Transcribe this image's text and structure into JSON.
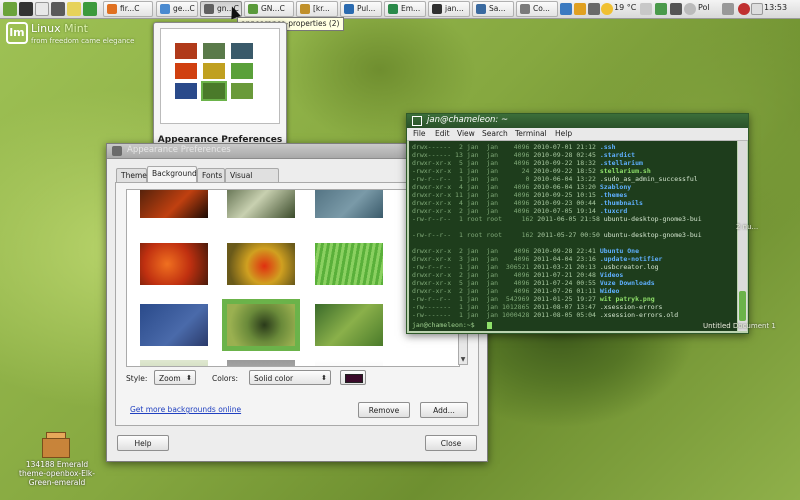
{
  "panel": {
    "tasks": [
      {
        "label": "fir...C",
        "active": false,
        "color": "#e07020"
      },
      {
        "label": "ge...C",
        "active": false,
        "color": "#4a8ad0"
      },
      {
        "label": "gn...C",
        "active": true,
        "color": "#606060"
      },
      {
        "label": "GN...C",
        "active": false,
        "color": "#5a9a3a"
      },
      {
        "label": "[kr...",
        "active": false,
        "color": "#c0902a"
      },
      {
        "label": "Pul...",
        "active": false,
        "color": "#2a6ab0"
      },
      {
        "label": "Em...",
        "active": false,
        "color": "#2a8a4a"
      },
      {
        "label": "jan...",
        "active": false,
        "color": "#303030"
      },
      {
        "label": "Sa...",
        "active": false,
        "color": "#3a6aa0"
      },
      {
        "label": "Co...",
        "active": false,
        "color": "#7a7a7a"
      }
    ],
    "weather": "19 °C",
    "user": "Pol",
    "clock": "13:53"
  },
  "tooltip": "appearance-properties (2)",
  "desktop": {
    "logo_mark": "lm",
    "logo_word1": "Linux",
    "logo_word2": "Mint",
    "tagline": "from freedom came elegance",
    "icon_label": "134188 Emerald theme-openbox-Elk-Green-emerald",
    "watermark1": "Untitled Document 1",
    "watermark2": "2 nu..."
  },
  "preview": {
    "title": "Appearance Preferences"
  },
  "appearance": {
    "title": "Appearance Preferences",
    "tabs": [
      "Theme",
      "Background",
      "Fonts",
      "Visual Effects"
    ],
    "active_tab": 1,
    "style_label": "Style:",
    "style_value": "Zoom",
    "colors_label": "Colors:",
    "colors_value": "Solid color",
    "swatch_color": "#3a0a2a",
    "get_more": "Get more backgrounds online",
    "remove": "Remove",
    "add": "Add...",
    "help": "Help",
    "close": "Close"
  },
  "terminal": {
    "title": "jan@chameleon: ~",
    "menu": [
      "File",
      "Edit",
      "View",
      "Search",
      "Terminal",
      "Help"
    ],
    "lines": [
      {
        "perm": "drwx------  2 jan  jan",
        "size": "4096",
        "date": "2010-07-01 21:12",
        "name": ".ssh",
        "kind": "dir"
      },
      {
        "perm": "drwx------ 13 jan  jan",
        "size": "4096",
        "date": "2010-09-28 02:45",
        "name": ".stardict",
        "kind": "dir"
      },
      {
        "perm": "drwxr-xr-x  5 jan  jan",
        "size": "4096",
        "date": "2010-09-22 18:32",
        "name": ".stellarium",
        "kind": "dir"
      },
      {
        "perm": "-rwxr-xr-x  1 jan  jan",
        "size": "24",
        "date": "2010-09-22 18:52",
        "name": "stellarium.sh",
        "kind": "exe"
      },
      {
        "perm": "-rw-r--r--  1 jan  jan",
        "size": "0",
        "date": "2010-06-04 13:22",
        "name": ".sudo_as_admin_successful",
        "kind": "file"
      },
      {
        "perm": "drwxr-xr-x  4 jan  jan",
        "size": "4096",
        "date": "2010-06-04 13:20",
        "name": "Szablony",
        "kind": "dir"
      },
      {
        "perm": "drwxr-xr-x 11 jan  jan",
        "size": "4096",
        "date": "2010-09-25 10:15",
        "name": ".themes",
        "kind": "dir"
      },
      {
        "perm": "drwxr-xr-x  4 jan  jan",
        "size": "4096",
        "date": "2010-09-23 00:44",
        "name": ".thumbnails",
        "kind": "dir"
      },
      {
        "perm": "drwxr-xr-x  2 jan  jan",
        "size": "4096",
        "date": "2010-07-05 19:14",
        "name": ".tuxcrd",
        "kind": "dir"
      },
      {
        "perm": "-rw-r--r--  1 root root",
        "size": "162",
        "date": "2011-06-05 21:58",
        "name": "ubuntu-desktop-gnome3-bui",
        "kind": "file"
      },
      {
        "perm": "",
        "size": "",
        "date": "",
        "name": "",
        "kind": "file"
      },
      {
        "perm": "-rw-r--r--  1 root root",
        "size": "162",
        "date": "2011-05-27 00:50",
        "name": "ubuntu-desktop-gnome3-bui",
        "kind": "file"
      },
      {
        "perm": "",
        "size": "",
        "date": "",
        "name": "",
        "kind": "file"
      },
      {
        "perm": "drwxr-xr-x  2 jan  jan",
        "size": "4096",
        "date": "2010-09-28 22:41",
        "name": "Ubuntu One",
        "kind": "dir"
      },
      {
        "perm": "drwxr-xr-x  3 jan  jan",
        "size": "4096",
        "date": "2011-04-04 23:16",
        "name": ".update-notifier",
        "kind": "dir"
      },
      {
        "perm": "-rw-r--r--  1 jan  jan",
        "size": "306521",
        "date": "2011-03-21 20:13",
        "name": ".usbcreator.log",
        "kind": "file"
      },
      {
        "perm": "drwxr-xr-x  2 jan  jan",
        "size": "4096",
        "date": "2011-07-21 20:48",
        "name": "Videos",
        "kind": "dir"
      },
      {
        "perm": "drwxr-xr-x  5 jan  jan",
        "size": "4096",
        "date": "2011-07-24 00:55",
        "name": "Vuze Downloads",
        "kind": "dir"
      },
      {
        "perm": "drwxr-xr-x  2 jan  jan",
        "size": "4096",
        "date": "2011-07-26 01:11",
        "name": "Wideo",
        "kind": "dir"
      },
      {
        "perm": "-rw-r--r--  1 jan  jan",
        "size": "542969",
        "date": "2011-01-25 19:27",
        "name": "wit patryk.png",
        "kind": "exe"
      },
      {
        "perm": "-rw-------  1 jan  jan",
        "size": "1012865",
        "date": "2011-08-07 13:47",
        "name": ".xsession-errors",
        "kind": "file"
      },
      {
        "perm": "-rw-------  1 jan  jan",
        "size": "1000428",
        "date": "2011-08-05 05:04",
        "name": ".xsession-errors.old",
        "kind": "file"
      }
    ],
    "prompt": "jan@chameleon:~$"
  }
}
